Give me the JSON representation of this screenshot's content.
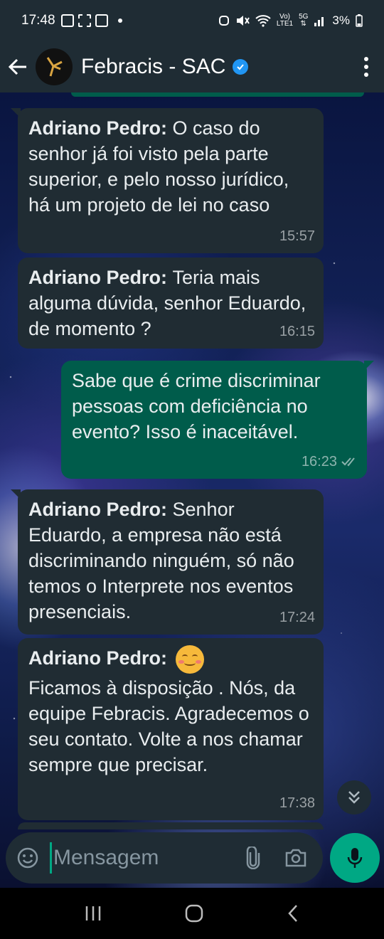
{
  "status_bar": {
    "time": "17:48",
    "network_top": "Vo)",
    "network_bottom": "LTE1",
    "network5g_top": "5G",
    "battery": "3%"
  },
  "header": {
    "contact_name": "Febracis - SAC",
    "verified_icon": "verified-badge-icon",
    "accent_color": "#2196f3"
  },
  "messages": [
    {
      "direction": "incoming",
      "sender": "Adriano Pedro:",
      "text": "O caso do senhor já foi visto pela parte superior, e pelo nosso jurídico, há um projeto de lei no caso",
      "time": "15:57"
    },
    {
      "direction": "incoming",
      "sender": "Adriano Pedro:",
      "text": "Teria mais alguma dúvida, senhor Eduardo, de momento ?",
      "time": "16:15"
    },
    {
      "direction": "outgoing",
      "text": "Sabe que é crime discriminar pessoas com deficiência no evento? Isso é inaceitável.",
      "time": "16:23",
      "status": "read"
    },
    {
      "direction": "incoming",
      "sender": "Adriano Pedro:",
      "text": "Senhor Eduardo, a empresa não está discriminando ninguém, só não temos o Interprete nos eventos presenciais.",
      "time": "17:24"
    },
    {
      "direction": "incoming",
      "sender": "Adriano Pedro:",
      "emoji": "smiling-face-icon",
      "text": "Ficamos à disposição . Nós, da equipe Febracis. Agradecemos o seu contato. Volte a nos chamar sempre que precisar.",
      "time": "17:38"
    }
  ],
  "composer": {
    "placeholder": "Mensagem"
  },
  "colors": {
    "incoming_bubble": "#202c33",
    "outgoing_bubble": "#005c4b",
    "bar_background": "#1f2c34",
    "mic_button": "#00a884"
  }
}
